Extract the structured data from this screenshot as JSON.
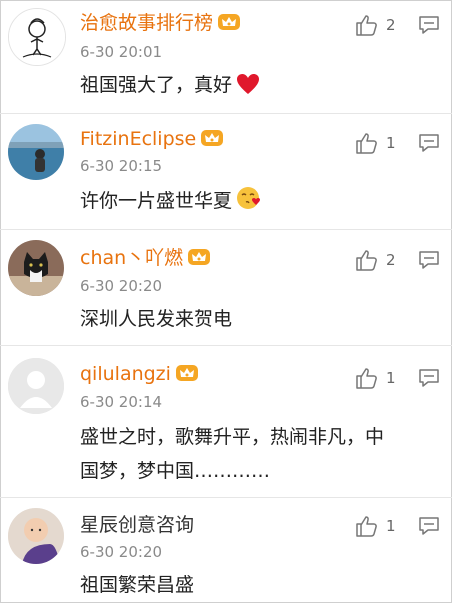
{
  "comments": [
    {
      "username": "治愈故事排行榜",
      "time": "6-30 20:01",
      "text": "祖国强大了，真好",
      "emoji": "heart-emoji",
      "likes": "2",
      "vip": true
    },
    {
      "username": "FitzinEclipse",
      "time": "6-30 20:15",
      "text": "许你一片盛世华夏",
      "emoji": "kiss-emoji",
      "likes": "1",
      "vip": true
    },
    {
      "username": "chan丶吖燃",
      "time": "6-30 20:20",
      "text": "深圳人民发来贺电",
      "likes": "2",
      "vip": true
    },
    {
      "username": "qilulangzi",
      "time": "6-30 20:14",
      "text_line1": "盛世之时，歌舞升平，热闹非凡，中",
      "text_line2": "国梦，梦中国…………",
      "likes": "1",
      "vip": true
    },
    {
      "username": "星辰创意咨询",
      "time": "6-30 20:20",
      "text": "祖国繁荣昌盛",
      "likes": "1",
      "vip": false
    }
  ],
  "colors": {
    "vip_name": "#e8730f",
    "plain_name": "#333333",
    "time": "#8a8a8a",
    "heart": "#e0182c"
  }
}
